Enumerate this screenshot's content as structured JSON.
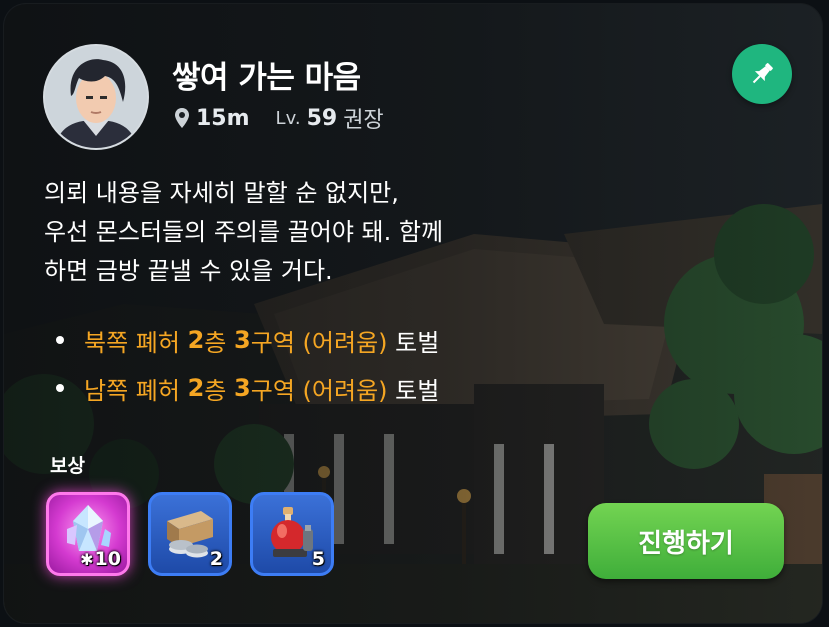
{
  "quest": {
    "title": "쌓여 가는 마음",
    "distance": "15m",
    "level_prefix": "Lv.",
    "level": "59",
    "level_suffix": "권장"
  },
  "description": [
    "의뢰 내용을 자세히 말할 순 없지만,",
    "우선 몬스터들의 주의를 끌어야 돼. 함께",
    "하면 금방 끝낼 수 있을 거다."
  ],
  "objectives": [
    {
      "area": "북쪽 폐허",
      "floor": "2",
      "floor_unit": "층",
      "zone": "3",
      "zone_unit": "구역",
      "difficulty": "(어려움)",
      "action": "토벌"
    },
    {
      "area": "남쪽 폐허",
      "floor": "2",
      "floor_unit": "층",
      "zone": "3",
      "zone_unit": "구역",
      "difficulty": "(어려움)",
      "action": "토벌"
    }
  ],
  "rewards": {
    "label": "보상",
    "items": [
      {
        "icon": "crystal-icon",
        "quantity": "10",
        "prefix": "✱"
      },
      {
        "icon": "silver-chest-icon",
        "quantity": "2"
      },
      {
        "icon": "potion-icon",
        "quantity": "5"
      }
    ]
  },
  "actions": {
    "proceed_label": "진행하기"
  },
  "colors": {
    "accent_orange": "#f5a623",
    "pin_green": "#1fb67f",
    "button_green": "#4fbf3f",
    "epic_pink": "#ff79ec",
    "rare_blue": "#3d7df5"
  }
}
